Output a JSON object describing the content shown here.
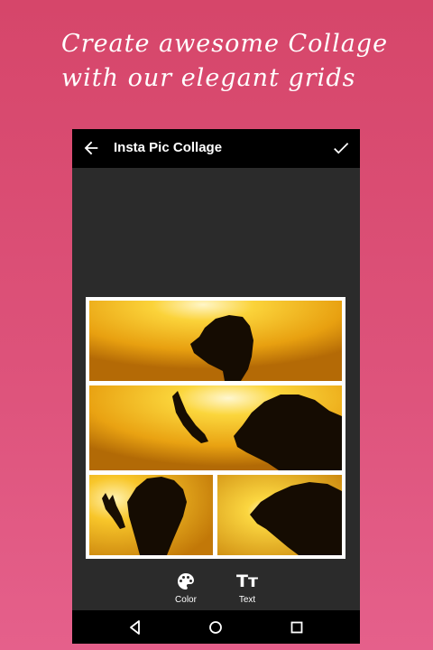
{
  "promo": {
    "line1": "Create awesome Collage",
    "line2": "with our elegant grids"
  },
  "app": {
    "title": "Insta Pic Collage",
    "back_icon": "arrow-left-icon",
    "done_icon": "check-icon"
  },
  "tools": [
    {
      "label": "Color",
      "icon": "palette-icon"
    },
    {
      "label": "Text",
      "icon": "text-size-icon",
      "glyph": "Tт"
    }
  ],
  "navbar": {
    "icons": [
      "nav-back-icon",
      "nav-home-icon",
      "nav-recents-icon"
    ]
  },
  "colors": {
    "background_top": "#d6466a",
    "background_bottom": "#e5608b",
    "app_bar": "#000000",
    "canvas": "#2b2b2b",
    "photo_sun": "#f4b81c"
  }
}
